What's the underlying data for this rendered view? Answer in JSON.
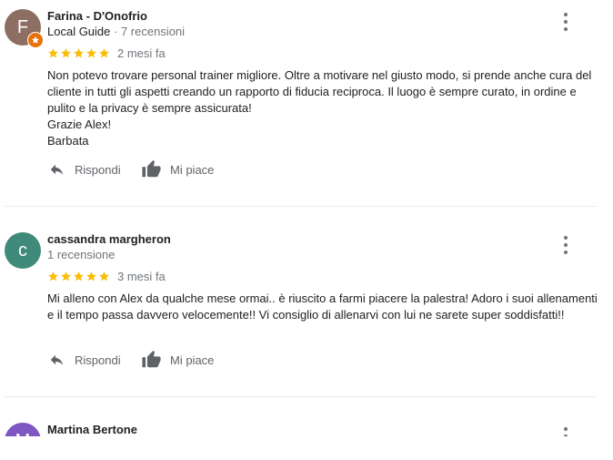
{
  "reviews": [
    {
      "author": "Farina - D'Onofrio",
      "avatar_letter": "F",
      "avatar_color": "#8d6e63",
      "local_guide_label": "Local Guide",
      "separator": " · ",
      "review_count": "7 recensioni",
      "rating": 5,
      "date": "2 mesi fa",
      "text_lines": [
        "Non potevo trovare personal trainer migliore. Oltre a motivare nel giusto modo, si prende anche cura del cliente in tutti gli aspetti creando un rapporto di fiducia reciproca. Il luogo è sempre curato, in ordine e pulito e la privacy è sempre assicurata!",
        "Grazie Alex!",
        "Barbata"
      ],
      "reply_label": "Rispondi",
      "like_label": "Mi piace"
    },
    {
      "author": "cassandra margheron",
      "avatar_letter": "c",
      "avatar_color": "#3f8a7a",
      "review_count": "1 recensione",
      "rating": 5,
      "date": "3 mesi fa",
      "text_lines": [
        "Mi alleno con Alex da qualche mese ormai.. è riuscito a farmi piacere la palestra! Adoro i suoi allenamenti e il tempo passa davvero velocemente!! Vi consiglio di allenarvi con lui ne sarete super soddisfatti!!"
      ],
      "reply_label": "Rispondi",
      "like_label": "Mi piace"
    },
    {
      "author": "Martina Bertone",
      "avatar_letter": "M",
      "avatar_color": "#7e57c2"
    }
  ],
  "colors": {
    "star": "#fbbc04",
    "divider": "#e8eaed",
    "secondary_text": "#70757a",
    "local_guide_badge": "#e8710a"
  },
  "icons": [
    "star-icon",
    "reply-icon",
    "thumbs-up-icon",
    "more-vert-icon",
    "local-guide-badge-icon"
  ]
}
